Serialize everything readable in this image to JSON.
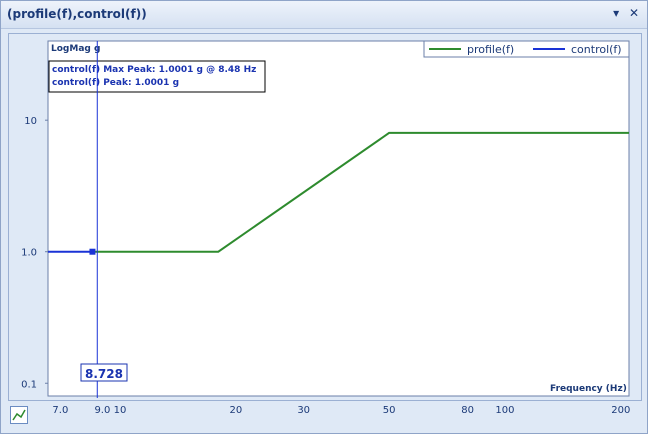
{
  "window": {
    "title": "(profile(f),control(f))",
    "pin_icon": "pin-down-icon",
    "close_icon": "close-icon",
    "pin_glyph": "▾",
    "close_glyph": "✕"
  },
  "plot": {
    "ylabel": "LogMag g",
    "xlabel": "Frequency (Hz)",
    "annotation_line1": "control(f) Max Peak: 1.0001 g @ 8.48 Hz",
    "annotation_line2": "control(f) Peak: 1.0001 g",
    "cursor_readout": "8.728",
    "colors": {
      "profile": "#2e8b2e",
      "control": "#1a33d6",
      "axis_text": "#1c3a78"
    }
  },
  "chart_data": {
    "type": "line",
    "title": "(profile(f),control(f))",
    "xlabel": "Frequency (Hz)",
    "ylabel": "LogMag g",
    "x_scale": "log",
    "y_scale": "log",
    "xlim": [
      6.5,
      210
    ],
    "ylim": [
      0.08,
      40
    ],
    "x_ticks": [
      "7.0",
      "9.0",
      "10",
      "20",
      "30",
      "50",
      "80",
      "100",
      "200"
    ],
    "y_ticks": [
      "0.1",
      "1.0",
      "10"
    ],
    "legend_position": "top-right",
    "series": [
      {
        "name": "profile(f)",
        "color": "#2e8b2e",
        "x": [
          8.48,
          18,
          50,
          210
        ],
        "y": [
          1.0,
          1.0,
          8.0,
          8.0
        ]
      },
      {
        "name": "control(f)",
        "color": "#1a33d6",
        "x": [
          6.5,
          8.48
        ],
        "y": [
          1.0001,
          1.0001
        ]
      }
    ],
    "cursor_x": 8.728
  }
}
